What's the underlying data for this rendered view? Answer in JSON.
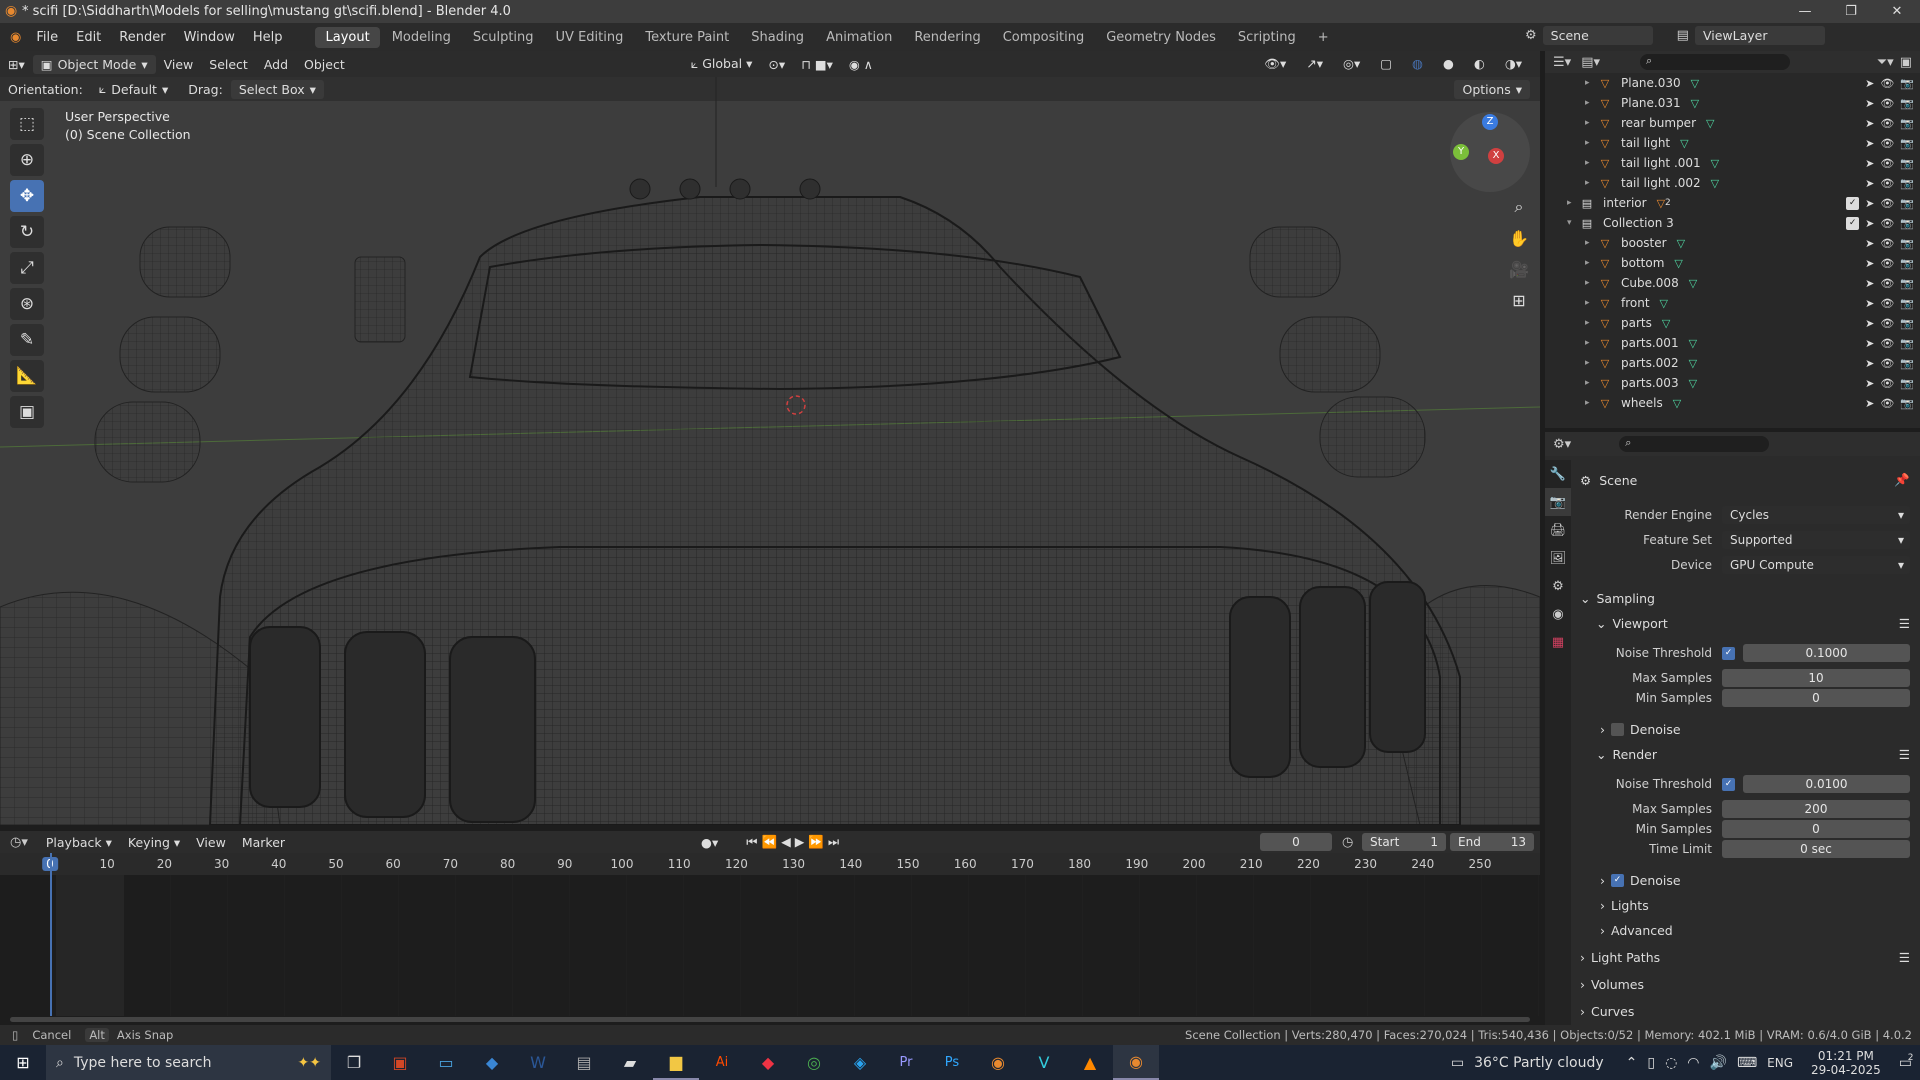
{
  "title_bar": {
    "title": "* scifi [D:\\Siddharth\\Models for selling\\mustang gt\\scifi.blend] - Blender 4.0"
  },
  "menus": [
    "File",
    "Edit",
    "Render",
    "Window",
    "Help"
  ],
  "workspaces": [
    "Layout",
    "Modeling",
    "Sculpting",
    "UV Editing",
    "Texture Paint",
    "Shading",
    "Animation",
    "Rendering",
    "Compositing",
    "Geometry Nodes",
    "Scripting"
  ],
  "active_workspace": "Layout",
  "scene": {
    "label": "Scene",
    "view_layer": "ViewLayer"
  },
  "viewport_header": {
    "mode": "Object Mode",
    "view": "View",
    "select": "Select",
    "add": "Add",
    "object": "Object",
    "transform": "Global"
  },
  "viewport_options": {
    "orientation_label": "Orientation:",
    "orientation": "Default",
    "drag_label": "Drag:",
    "drag": "Select Box",
    "options": "Options"
  },
  "viewport_info": {
    "perspective": "User Perspective",
    "collection": "(0) Scene Collection"
  },
  "gizmo": {
    "z": "Z",
    "y": "Y",
    "x": "X"
  },
  "outliner": {
    "rows": [
      {
        "name": "Plane.030",
        "indent": 2
      },
      {
        "name": "Plane.031",
        "indent": 2
      },
      {
        "name": "rear bumper",
        "indent": 2
      },
      {
        "name": "tail light",
        "indent": 2
      },
      {
        "name": "tail light .001",
        "indent": 2
      },
      {
        "name": "tail light .002",
        "indent": 2
      },
      {
        "name": "interior",
        "indent": 1,
        "collection": true
      },
      {
        "name": "Collection 3",
        "indent": 1,
        "collection": true
      },
      {
        "name": "booster",
        "indent": 2
      },
      {
        "name": "bottom",
        "indent": 2
      },
      {
        "name": "Cube.008",
        "indent": 2
      },
      {
        "name": "front",
        "indent": 2
      },
      {
        "name": "parts",
        "indent": 2
      },
      {
        "name": "parts.001",
        "indent": 2
      },
      {
        "name": "parts.002",
        "indent": 2
      },
      {
        "name": "parts.003",
        "indent": 2
      },
      {
        "name": "wheels",
        "indent": 2
      }
    ],
    "interior_badge": "2"
  },
  "properties": {
    "context": "Scene",
    "render_engine_label": "Render Engine",
    "render_engine": "Cycles",
    "feature_set_label": "Feature Set",
    "feature_set": "Supported",
    "device_label": "Device",
    "device": "GPU Compute",
    "sampling": "Sampling",
    "viewport": "Viewport",
    "vp_noise_label": "Noise Threshold",
    "vp_noise": "0.1000",
    "vp_max_label": "Max Samples",
    "vp_max": "10",
    "vp_min_label": "Min Samples",
    "vp_min": "0",
    "vp_denoise": "Denoise",
    "render": "Render",
    "r_noise_label": "Noise Threshold",
    "r_noise": "0.0100",
    "r_max_label": "Max Samples",
    "r_max": "200",
    "r_min_label": "Min Samples",
    "r_min": "0",
    "r_time_label": "Time Limit",
    "r_time": "0 sec",
    "r_denoise": "Denoise",
    "lights": "Lights",
    "advanced": "Advanced",
    "light_paths": "Light Paths",
    "volumes": "Volumes",
    "curves": "Curves"
  },
  "timeline": {
    "playback": "Playback",
    "keying": "Keying",
    "view": "View",
    "marker": "Marker",
    "current_frame": "0",
    "start_label": "Start",
    "start": "1",
    "end_label": "End",
    "end": "13",
    "ticks": [
      "0",
      "10",
      "20",
      "30",
      "40",
      "50",
      "60",
      "70",
      "80",
      "90",
      "100",
      "110",
      "120",
      "130",
      "140",
      "150",
      "160",
      "170",
      "180",
      "190",
      "200",
      "210",
      "220",
      "230",
      "240",
      "250"
    ]
  },
  "status_bar": {
    "cancel": "Cancel",
    "alt": "Alt",
    "axis_snap": "Axis Snap",
    "stats": "Scene Collection | Verts:280,470 | Faces:270,024 | Tris:540,436 | Objects:0/52 | Memory: 402.1 MiB | VRAM: 0.6/4.0 GiB | 4.0.2"
  },
  "taskbar": {
    "search_placeholder": "Type here to search",
    "weather": "36°C  Partly cloudy",
    "lang": "ENG",
    "time": "01:21 PM",
    "date": "29-04-2025",
    "notif": "2"
  },
  "colors": {
    "accent": "#4772b3",
    "object_icon": "#e8892f",
    "mesh_data": "#4fd4a0"
  }
}
